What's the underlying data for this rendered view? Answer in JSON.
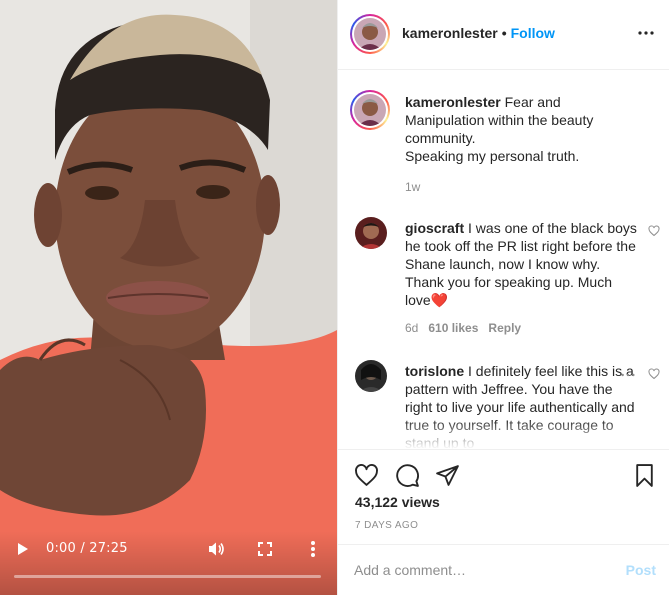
{
  "video": {
    "time_display": "0:00 / 27:25",
    "progress": 0,
    "icons": [
      "play-icon",
      "volume-icon",
      "fullscreen-icon",
      "more-vertical-icon"
    ]
  },
  "header": {
    "username": "kameronlester",
    "separator": "•",
    "follow_label": "Follow",
    "more_icon": "more-horizontal-icon"
  },
  "caption": {
    "username": "kameronlester",
    "text_line1": "Fear and Manipulation within the beauty community.",
    "text_line2": "Speaking my personal truth.",
    "age": "1w"
  },
  "comments": [
    {
      "username": "gioscraft",
      "text": "I was one of the black boys he took off the PR list right before the Shane launch, now I know why. Thank you for speaking up. Much love❤️",
      "age": "6d",
      "likes": "610 likes",
      "reply": "Reply"
    },
    {
      "username": "torislone",
      "text": "I definitely feel like this is a pattern with Jeffree. You have the right to live your life authentically and true to yourself. It take courage to stand up to"
    }
  ],
  "actions": {
    "icons": [
      "heart-icon",
      "comment-icon",
      "share-icon",
      "bookmark-icon"
    ],
    "views": "43,122 views",
    "date": "7 DAYS AGO"
  },
  "comment_bar": {
    "placeholder": "Add a comment…",
    "post_label": "Post"
  },
  "colors": {
    "link_blue": "#0095f6",
    "post_disabled": "#b2dffc",
    "muted": "#8e8e8e",
    "text": "#262626",
    "border": "#efefef"
  }
}
